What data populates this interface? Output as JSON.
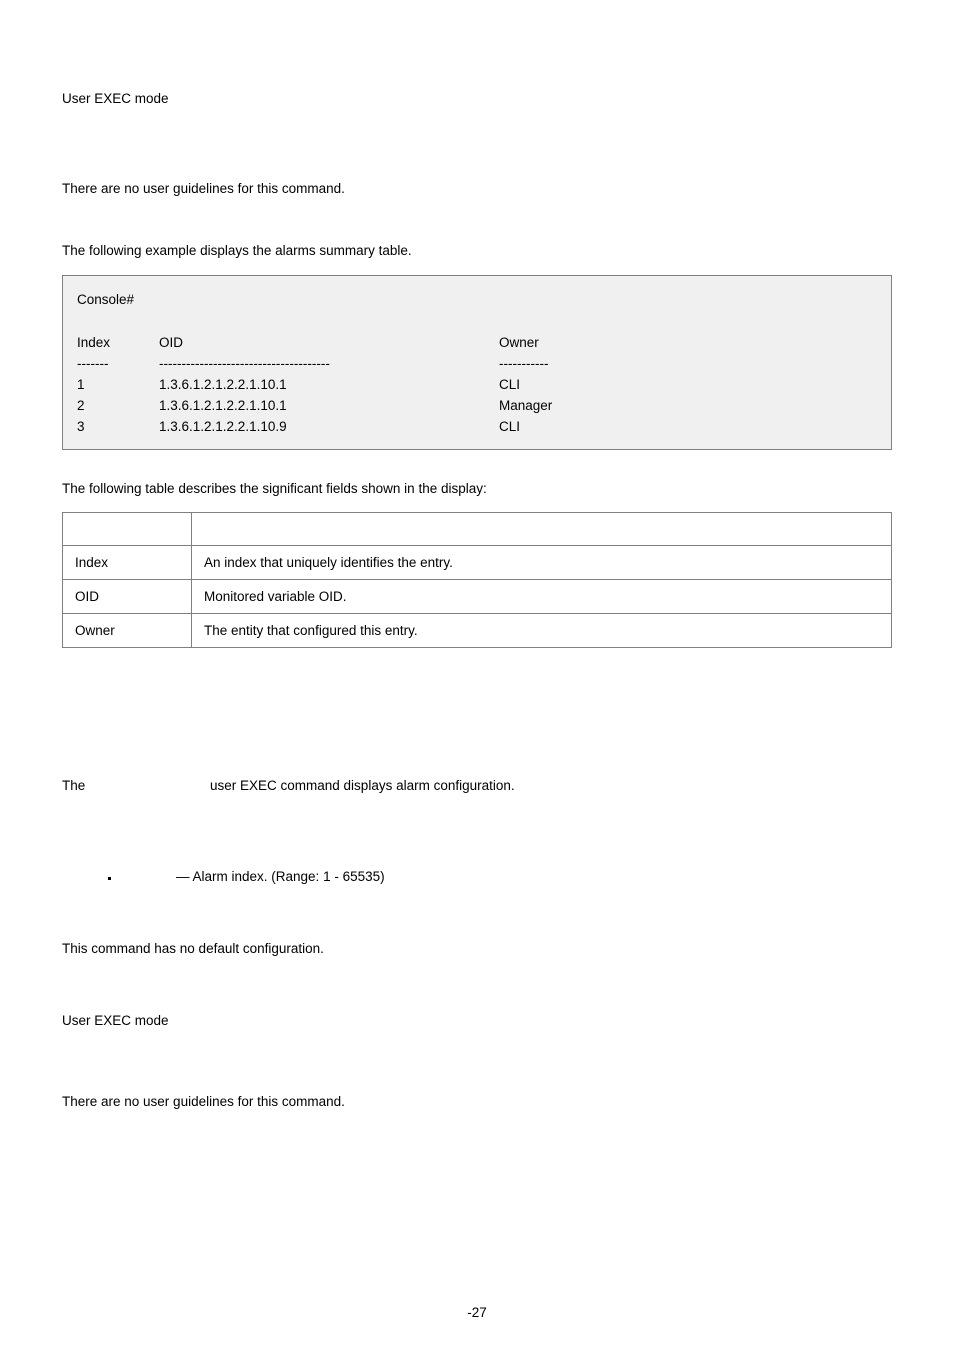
{
  "section1": {
    "mode": "User EXEC mode",
    "guidelines": "There are no user guidelines for this command.",
    "example_intro": "The following example displays the alarms summary table."
  },
  "console": {
    "prompt": "Console#",
    "headers": {
      "index": "Index",
      "oid": "OID",
      "owner": "Owner"
    },
    "dividers": {
      "index": "-------",
      "oid": "--------------------------------------",
      "owner": "-----------"
    },
    "rows": [
      {
        "index": "1",
        "oid": "1.3.6.1.2.1.2.2.1.10.1",
        "owner": "CLI"
      },
      {
        "index": "2",
        "oid": "1.3.6.1.2.1.2.2.1.10.1",
        "owner": "Manager"
      },
      {
        "index": "3",
        "oid": "1.3.6.1.2.1.2.2.1.10.9",
        "owner": "CLI"
      }
    ]
  },
  "fields_intro": "The following table describes the significant fields shown in the display:",
  "fields": [
    {
      "name": "Index",
      "desc": "An index that uniquely identifies the entry."
    },
    {
      "name": "OID",
      "desc": "Monitored variable OID."
    },
    {
      "name": "Owner",
      "desc": "The entity that configured this entry."
    }
  ],
  "section2": {
    "lead": "The",
    "tail": "user EXEC command displays alarm configuration.",
    "param": "— Alarm index. (Range: 1 - 65535)",
    "default_cfg": "This command has no default configuration.",
    "mode": "User EXEC mode",
    "guidelines": "There are no user guidelines for this command."
  },
  "page_number": "-27"
}
